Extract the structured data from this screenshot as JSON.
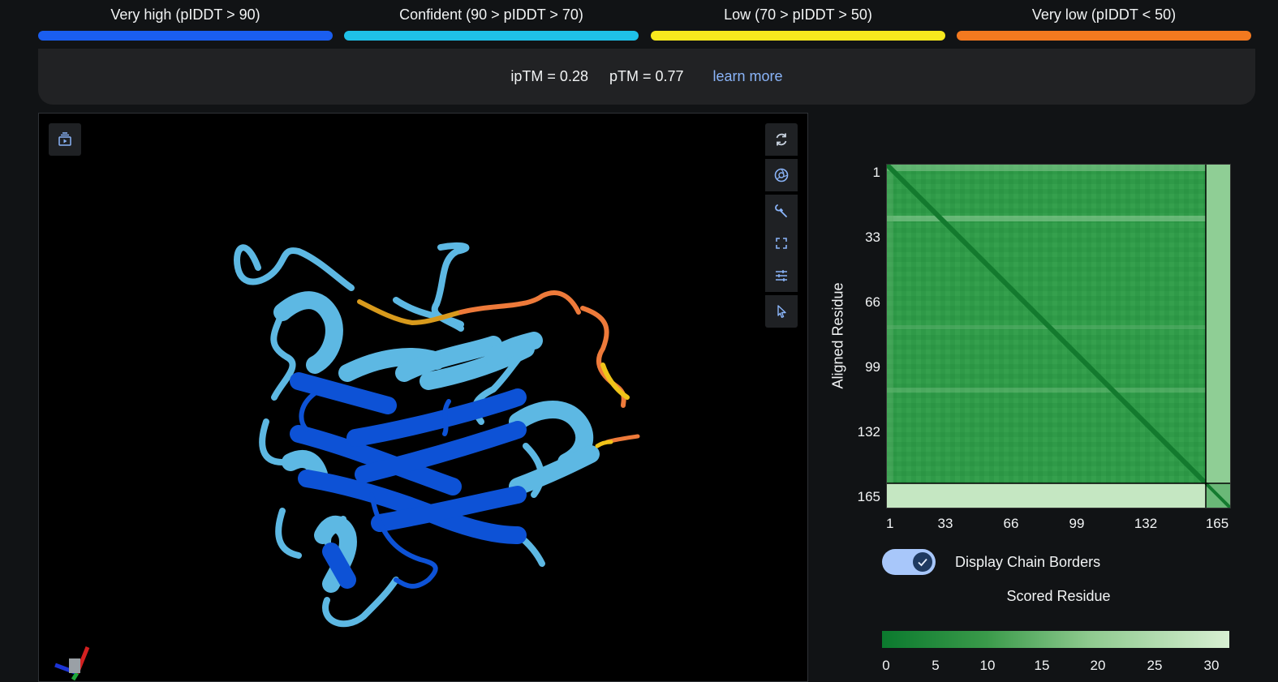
{
  "legend": [
    {
      "label": "Very high (pIDDT > 90)",
      "color": "#1a5ef0"
    },
    {
      "label": "Confident (90 > pIDDT > 70)",
      "color": "#1fc1e8"
    },
    {
      "label": "Low (70 > pIDDT > 50)",
      "color": "#f7e81e"
    },
    {
      "label": "Very low (pIDDT < 50)",
      "color": "#f3791f"
    }
  ],
  "scores": {
    "iptm": "ipTM = 0.28",
    "ptm": "pTM = 0.77",
    "learn_more": "learn more"
  },
  "viewer": {
    "icons": [
      "sequence-play-icon",
      "reset-rotation-icon",
      "screenshot-icon",
      "wrench-icon",
      "fullscreen-icon",
      "controls-icon",
      "cursor-icon"
    ]
  },
  "pae": {
    "y_axis_label": "Aligned Residue",
    "x_axis_label": "Scored Residue",
    "ticks": [
      "1",
      "33",
      "66",
      "99",
      "132",
      "165"
    ],
    "chain_borders_label": "Display Chain Borders",
    "chain_borders_on": true,
    "colorbar_ticks": [
      "0",
      "5",
      "10",
      "15",
      "20",
      "25",
      "30"
    ]
  }
}
